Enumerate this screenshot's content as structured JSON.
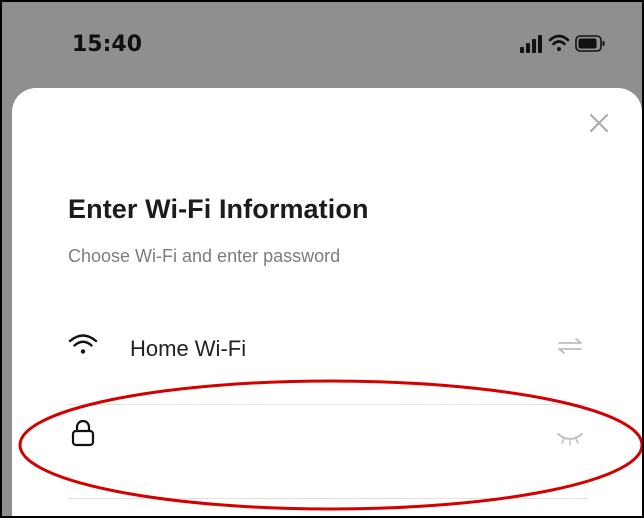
{
  "status_bar": {
    "time": "15:40",
    "icons": [
      "cellular-signal-icon",
      "wifi-icon",
      "battery-icon"
    ]
  },
  "sheet": {
    "close_icon": "close-icon",
    "title": "Enter Wi-Fi Information",
    "subtitle": "Choose Wi-Fi and enter password",
    "wifi_row": {
      "icon": "wifi-icon",
      "ssid": "Home Wi-Fi",
      "switch_icon": "swap-arrows-icon"
    },
    "password_row": {
      "icon": "lock-icon",
      "value": "",
      "placeholder": "",
      "toggle_icon": "eye-closed-icon"
    }
  },
  "annotation": {
    "shape": "ellipse",
    "color": "#d40000"
  },
  "colors": {
    "status_bg": "#8f8f8f",
    "sheet_bg": "#ffffff",
    "title": "#1c1c1c",
    "subtitle": "#7d7d7d",
    "divider": "#e3e3e3",
    "icon_light": "#bdbdbd"
  }
}
